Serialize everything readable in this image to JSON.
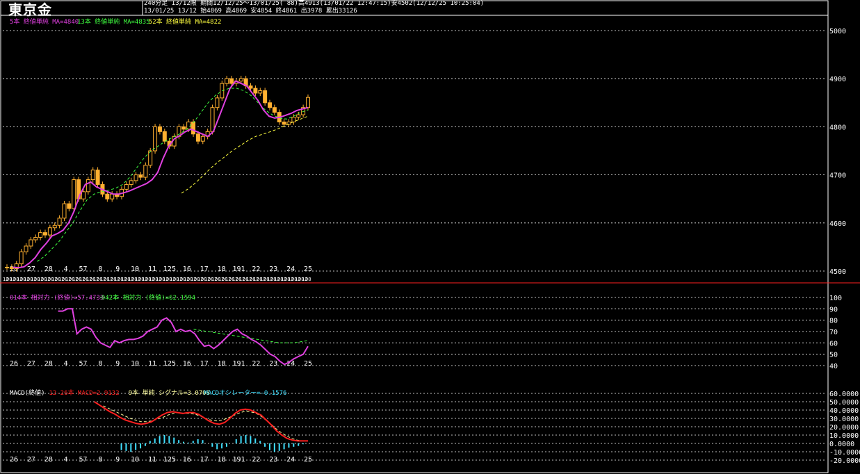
{
  "header": {
    "title": "東京金",
    "line1": "240分足 13/12限 期間12/12/25〜13/01/25( 88)高4913(13/01/22 12:47:15)安4502(12/12/25 10:25:04)",
    "line2": "13/01/25 13/12 始4869 高4869 安4854 終4861 出3978 累出33126"
  },
  "colors": {
    "background": "#000000",
    "candle_up": "#ffb030",
    "candle_down": "#ffb030",
    "ma5": "#e040e0",
    "ma13": "#40ff40",
    "ma52": "#ffff40",
    "rsi14": "#e040e0",
    "rsi42": "#40ff40",
    "macd": "#ff2020",
    "signal": "#ffffa0",
    "osc": "#40e0ff",
    "separator": "#ff2020",
    "grid": "#ffffff"
  },
  "chart_data": [
    {
      "type": "candlestick",
      "panel": "price",
      "ylim": [
        4500,
        5000
      ],
      "ticks": [
        "5000",
        "4900",
        "4800",
        "4700",
        "4600",
        "4500"
      ],
      "tick_values": [
        5000,
        4900,
        4800,
        4700,
        4600,
        4500
      ],
      "legend": [
        {
          "text": "5本 終値単純 MA=4840",
          "color_key": "ma5"
        },
        {
          "text": "13本 終値単純 MA=4835",
          "color_key": "ma13"
        },
        {
          "text": "52本 終値単純 MA=4822",
          "color_key": "ma52"
        }
      ],
      "x_day_labels": [
        "26",
        "27",
        "28",
        "4",
        "57",
        "8",
        "9",
        "10",
        "11",
        "125",
        "16",
        "17",
        "18",
        "191",
        "22",
        "23",
        "24",
        "25"
      ],
      "x_hour_labels": [
        "12",
        "08",
        "12",
        "08",
        "12",
        "08",
        "12",
        "08",
        "12",
        "08",
        "12",
        "08",
        "12",
        "08",
        "12",
        "08",
        "12",
        "08",
        "12",
        "08",
        "12",
        "08",
        "12",
        "08",
        "12",
        "08",
        "12",
        "08",
        "12",
        "08",
        "12",
        "08",
        "12",
        "08",
        "12",
        "08",
        "12",
        "08",
        "12",
        "08",
        "12",
        "08",
        "12",
        "08",
        "12",
        "08",
        "12",
        "08",
        "12",
        "08",
        "12",
        "08",
        "12",
        "08",
        "12",
        "08",
        "12",
        "08",
        "12",
        "08",
        "12",
        "08",
        "12",
        "08",
        "12",
        "08",
        "12",
        "08",
        "12",
        "08",
        "12",
        "08",
        "12",
        "08",
        "12",
        "08",
        "12",
        "08",
        "12",
        "08",
        "12",
        "08",
        "12",
        "08",
        "12",
        "08",
        "12",
        "08"
      ],
      "close": [
        4508,
        4505,
        4515,
        4540,
        4552,
        4565,
        4570,
        4580,
        4575,
        4590,
        4595,
        4610,
        4640,
        4630,
        4690,
        4650,
        4665,
        4690,
        4710,
        4680,
        4660,
        4650,
        4660,
        4655,
        4670,
        4680,
        4688,
        4700,
        4695,
        4720,
        4750,
        4800,
        4790,
        4770,
        4760,
        4780,
        4800,
        4795,
        4810,
        4785,
        4770,
        4780,
        4790,
        4840,
        4860,
        4890,
        4900,
        4890,
        4895,
        4900,
        4885,
        4880,
        4870,
        4875,
        4850,
        4840,
        4830,
        4810,
        4805,
        4810,
        4820,
        4825,
        4840,
        4861
      ],
      "ma5": [
        4508,
        4507,
        4509,
        4517,
        4528,
        4545,
        4558,
        4573,
        4578,
        4585,
        4600,
        4625,
        4658,
        4680,
        4685,
        4675,
        4670,
        4665,
        4660,
        4660,
        4663,
        4667,
        4672,
        4677,
        4682,
        4690,
        4705,
        4735,
        4760,
        4775,
        4782,
        4790,
        4795,
        4790,
        4785,
        4780,
        4790,
        4820,
        4850,
        4880,
        4895,
        4890,
        4885,
        4870,
        4855,
        4835,
        4822,
        4818,
        4820,
        4824,
        4828,
        4834,
        4837,
        4840
      ],
      "ma13": [
        4520,
        4530,
        4545,
        4560,
        4580,
        4600,
        4625,
        4648,
        4660,
        4665,
        4668,
        4672,
        4680,
        4695,
        4715,
        4735,
        4750,
        4760,
        4770,
        4778,
        4785,
        4795,
        4810,
        4830,
        4850,
        4865,
        4875,
        4880,
        4880,
        4875,
        4865,
        4850,
        4835,
        4825,
        4818,
        4816,
        4822,
        4830,
        4835
      ],
      "ma52": [
        4662,
        4672,
        4685,
        4700,
        4715,
        4728,
        4740,
        4752,
        4762,
        4772,
        4780,
        4785,
        4790,
        4796,
        4803,
        4810,
        4816,
        4822
      ]
    },
    {
      "type": "line",
      "panel": "rsi",
      "ylim": [
        40,
        100
      ],
      "ticks": [
        "100",
        "90",
        "80",
        "70",
        "60",
        "50",
        "40"
      ],
      "tick_values": [
        100,
        90,
        80,
        70,
        60,
        50,
        40
      ],
      "legend": [
        {
          "text": "014本 相対力 (終値)=57.4733",
          "color_key": "rsi14"
        },
        {
          "text": "042本 相対力 (終値)=62.1594",
          "color_key": "rsi42"
        }
      ],
      "x_day_labels": [
        "26",
        "27",
        "28",
        "4",
        "57",
        "8",
        "9",
        "10",
        "11",
        "125",
        "16",
        "17",
        "18",
        "191",
        "22",
        "23",
        "24",
        "25"
      ],
      "rsi14": [
        88,
        88,
        90,
        90,
        68,
        72,
        74,
        72,
        65,
        60,
        58,
        56,
        62,
        60,
        62,
        63,
        63,
        64,
        66,
        70,
        72,
        74,
        80,
        82,
        78,
        70,
        72,
        70,
        71,
        68,
        62,
        57,
        58,
        55,
        58,
        62,
        66,
        70,
        72,
        68,
        66,
        63,
        61,
        58,
        54,
        50,
        48,
        44,
        41,
        43,
        46,
        48,
        50,
        57
      ],
      "rsi42": [
        72,
        71,
        70,
        69,
        68,
        67,
        66,
        65,
        64,
        63,
        62,
        61,
        60,
        60,
        60,
        61,
        62
      ]
    },
    {
      "type": "line",
      "panel": "macd",
      "ylim": [
        -20,
        60
      ],
      "ticks": [
        "60.0000",
        "50.0000",
        "40.0000",
        "30.0000",
        "20.0000",
        "10.0000",
        "0.0000",
        "-10.0000",
        "-20.0000"
      ],
      "tick_values": [
        60,
        50,
        40,
        30,
        20,
        10,
        0,
        -10,
        -20
      ],
      "legend": [
        {
          "text": "MACD(終値)",
          "color_key": "grid"
        },
        {
          "text": "12-26本 MACD=2.9132",
          "color_key": "macd"
        },
        {
          "text": "9本 単純 シグナル=3.0708",
          "color_key": "signal"
        },
        {
          "text": "MACDオシレーター=-0.1576",
          "color_key": "osc"
        }
      ],
      "x_day_labels": [
        "26",
        "27",
        "28",
        "4",
        "57",
        "8",
        "9",
        "10",
        "11",
        "125",
        "16",
        "17",
        "18",
        "191",
        "22",
        "23",
        "24",
        "25"
      ],
      "macd": [
        50,
        46,
        42,
        38,
        35,
        31,
        28,
        26,
        24,
        23,
        24,
        26,
        30,
        34,
        37,
        38,
        37,
        36,
        37,
        37,
        35,
        31,
        27,
        24,
        23,
        25,
        30,
        36,
        40,
        41,
        40,
        37,
        34,
        28,
        22,
        15,
        10,
        6,
        4,
        3,
        3,
        3
      ],
      "signal": [
        45,
        42,
        39,
        36,
        33,
        30,
        28,
        26,
        26,
        27,
        29,
        31,
        34,
        36,
        37,
        36,
        36,
        35,
        33,
        30,
        28,
        27,
        28,
        30,
        33,
        36,
        38,
        38,
        37,
        34,
        29,
        24,
        18,
        13,
        9,
        6,
        4,
        3,
        3
      ],
      "osc": [
        -8,
        -9,
        -10,
        -8,
        -6,
        -3,
        3,
        6,
        9,
        10,
        9,
        7,
        4,
        2,
        1,
        3,
        5,
        4,
        0,
        -4,
        -7,
        -6,
        -4,
        0,
        5,
        9,
        10,
        9,
        6,
        3,
        -4,
        -8,
        -10,
        -9,
        -7,
        -5,
        -4,
        -3,
        -1,
        0
      ]
    }
  ]
}
